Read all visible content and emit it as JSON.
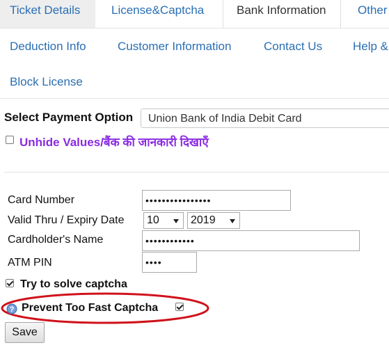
{
  "tabs_row1": [
    {
      "label": "Ticket Details"
    },
    {
      "label": "License&Captcha"
    },
    {
      "label": "Bank Information"
    },
    {
      "label": "Other"
    }
  ],
  "tabs_row2": [
    {
      "label": "Deduction Info"
    },
    {
      "label": "Customer Information"
    },
    {
      "label": "Contact Us"
    },
    {
      "label": "Help &"
    }
  ],
  "tabs_row3": [
    {
      "label": "Block License"
    }
  ],
  "payment": {
    "label": "Select Payment Option",
    "selected": "Union Bank of India Debit Card"
  },
  "unhide": {
    "label": "Unhide Values/बैंक की जानकारी दिखाएँ",
    "checked": false
  },
  "form": {
    "card_number_label": "Card Number",
    "card_number_value": "••••••••••••••••",
    "expiry_label": "Valid Thru / Expiry Date",
    "expiry_month": "10",
    "expiry_year": "2019",
    "cardholder_label": "Cardholder's Name",
    "cardholder_value": "••••••••••••",
    "atm_pin_label": "ATM PIN",
    "atm_pin_value": "••••"
  },
  "captcha": {
    "try_label": "Try to solve captcha",
    "try_checked": true,
    "prevent_label": "Prevent Too Fast Captcha",
    "prevent_checked": true
  },
  "save_button": "Save",
  "colors": {
    "tab_text": "#2a6fb3",
    "unhide_text": "#8a2be2",
    "highlight_ellipse": "#d0121b",
    "info_icon": "#4a78b8"
  }
}
